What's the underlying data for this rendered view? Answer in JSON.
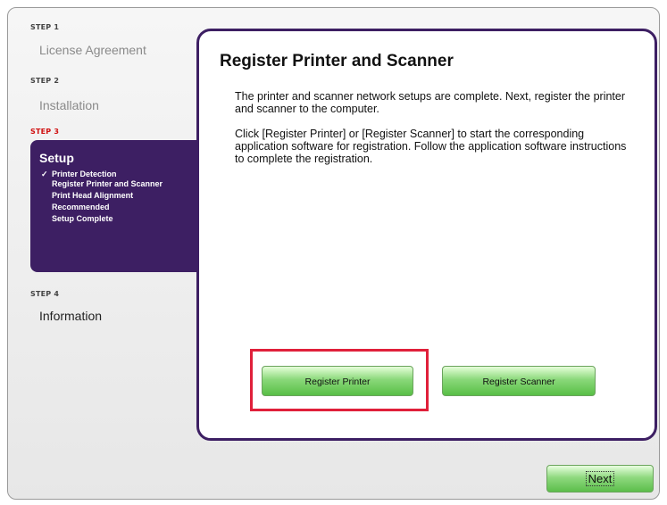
{
  "sidebar": {
    "steps": [
      {
        "label": "STEP 1",
        "title": "License Agreement"
      },
      {
        "label": "STEP 2",
        "title": "Installation"
      },
      {
        "label": "STEP 3",
        "title": "Setup"
      },
      {
        "label": "STEP 4",
        "title": "Information"
      }
    ],
    "setup_substeps": [
      {
        "text": "Printer Detection",
        "checked": true
      },
      {
        "text": "Register Printer and Scanner",
        "checked": false
      },
      {
        "text": "Print Head Alignment",
        "checked": false
      },
      {
        "text": "Recommended",
        "checked": false
      },
      {
        "text": "Setup Complete",
        "checked": false
      }
    ],
    "check_mark": "✓"
  },
  "main": {
    "title": "Register Printer and Scanner",
    "paragraph1": "The printer and scanner network setups are complete. Next, register the printer and scanner to the computer.",
    "paragraph2": "Click [Register Printer] or [Register Scanner] to start the corresponding application software for registration. Follow the application software instructions to complete the registration.",
    "register_printer_label": "Register Printer",
    "register_scanner_label": "Register Scanner"
  },
  "footer": {
    "next_label": "Next"
  },
  "colors": {
    "accent_purple": "#3d1f63",
    "active_step_red": "#d01010",
    "highlight_red": "#e0203a",
    "button_green": "#58bf46"
  }
}
